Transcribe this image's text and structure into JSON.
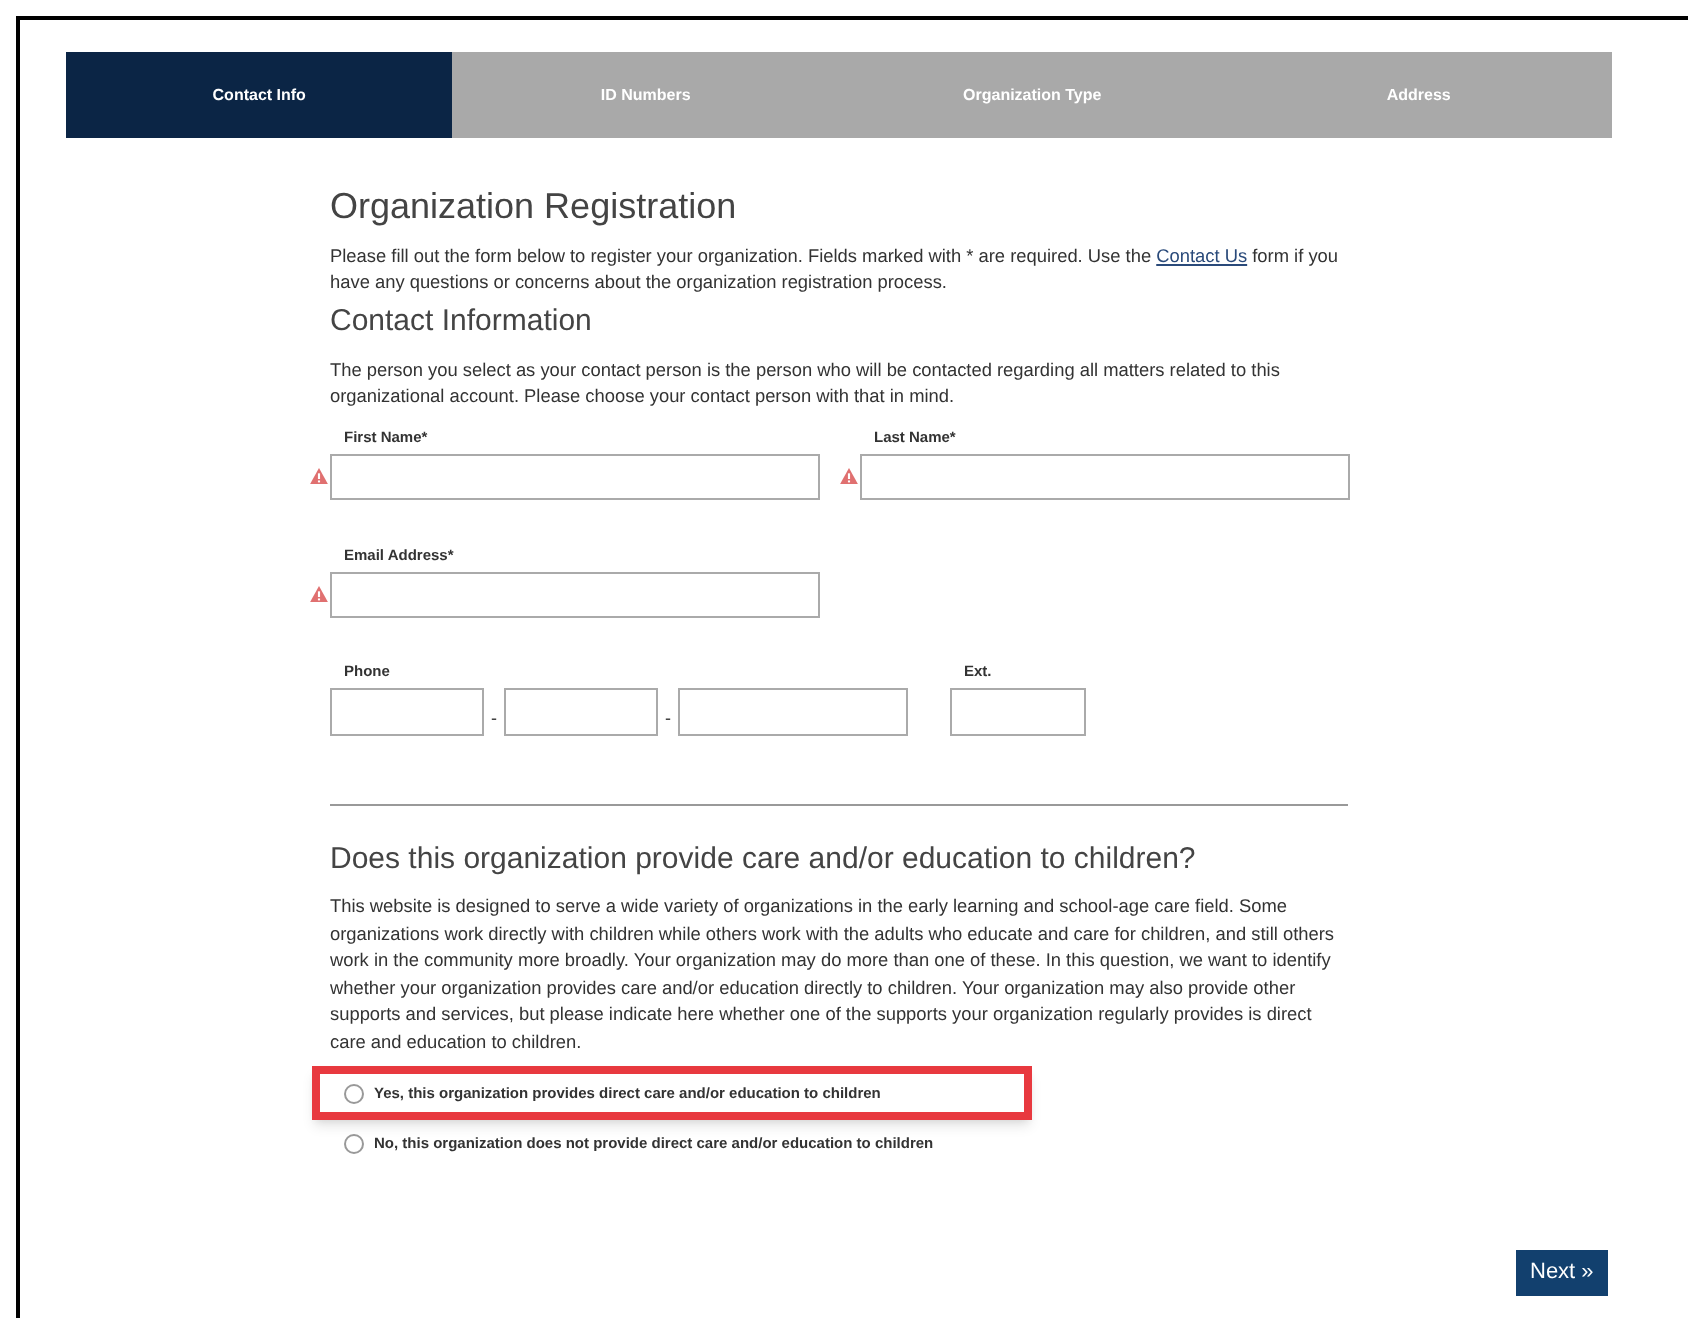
{
  "steps": [
    {
      "label": "Contact Info",
      "selected": true
    },
    {
      "label": "ID Numbers",
      "selected": false
    },
    {
      "label": "Organization Type",
      "selected": false
    },
    {
      "label": "Address",
      "selected": false
    }
  ],
  "title": "Organization Registration",
  "intro": {
    "before": "Please fill out the form below to register your organization. Fields marked with * are required. Use the ",
    "link": "Contact Us",
    "after": " form if you have any questions or concerns about the organization registration process."
  },
  "contact": {
    "heading": "Contact Information",
    "description": "The person you select as your contact person is the person who will be contacted regarding all matters related to this organizational account. Please choose your contact person with that in mind.",
    "fields": [
      {
        "label": "First Name*",
        "error": true
      },
      {
        "label": "Last Name*",
        "error": true
      },
      {
        "label": "Email Address*",
        "error": true
      }
    ],
    "phone": {
      "label": "Phone",
      "separators": [
        "-",
        "-"
      ]
    },
    "ext": {
      "label": "Ext."
    }
  },
  "question": {
    "heading": "Does this organization provide care and/or education to children?",
    "description": "This website is designed to serve a wide variety of organizations in the early learning and school-age care field. Some organizations work directly with children while others work with the adults who educate and care for children, and still others work in the community more broadly. Your organization may do more than one of these. In this question, we want to identify whether your organization provides care and/or education directly to children. Your organization may also provide other supports and services, but please indicate here whether one of the supports your organization regularly provides is direct care and education to children.",
    "options": [
      {
        "label": "Yes, this organization provides direct care and/or education to children",
        "selected": false,
        "highlighted": true
      },
      {
        "label": "No, this organization does not provide direct care and/or education to children",
        "selected": false,
        "highlighted": false
      }
    ]
  },
  "next_button": "Next »"
}
